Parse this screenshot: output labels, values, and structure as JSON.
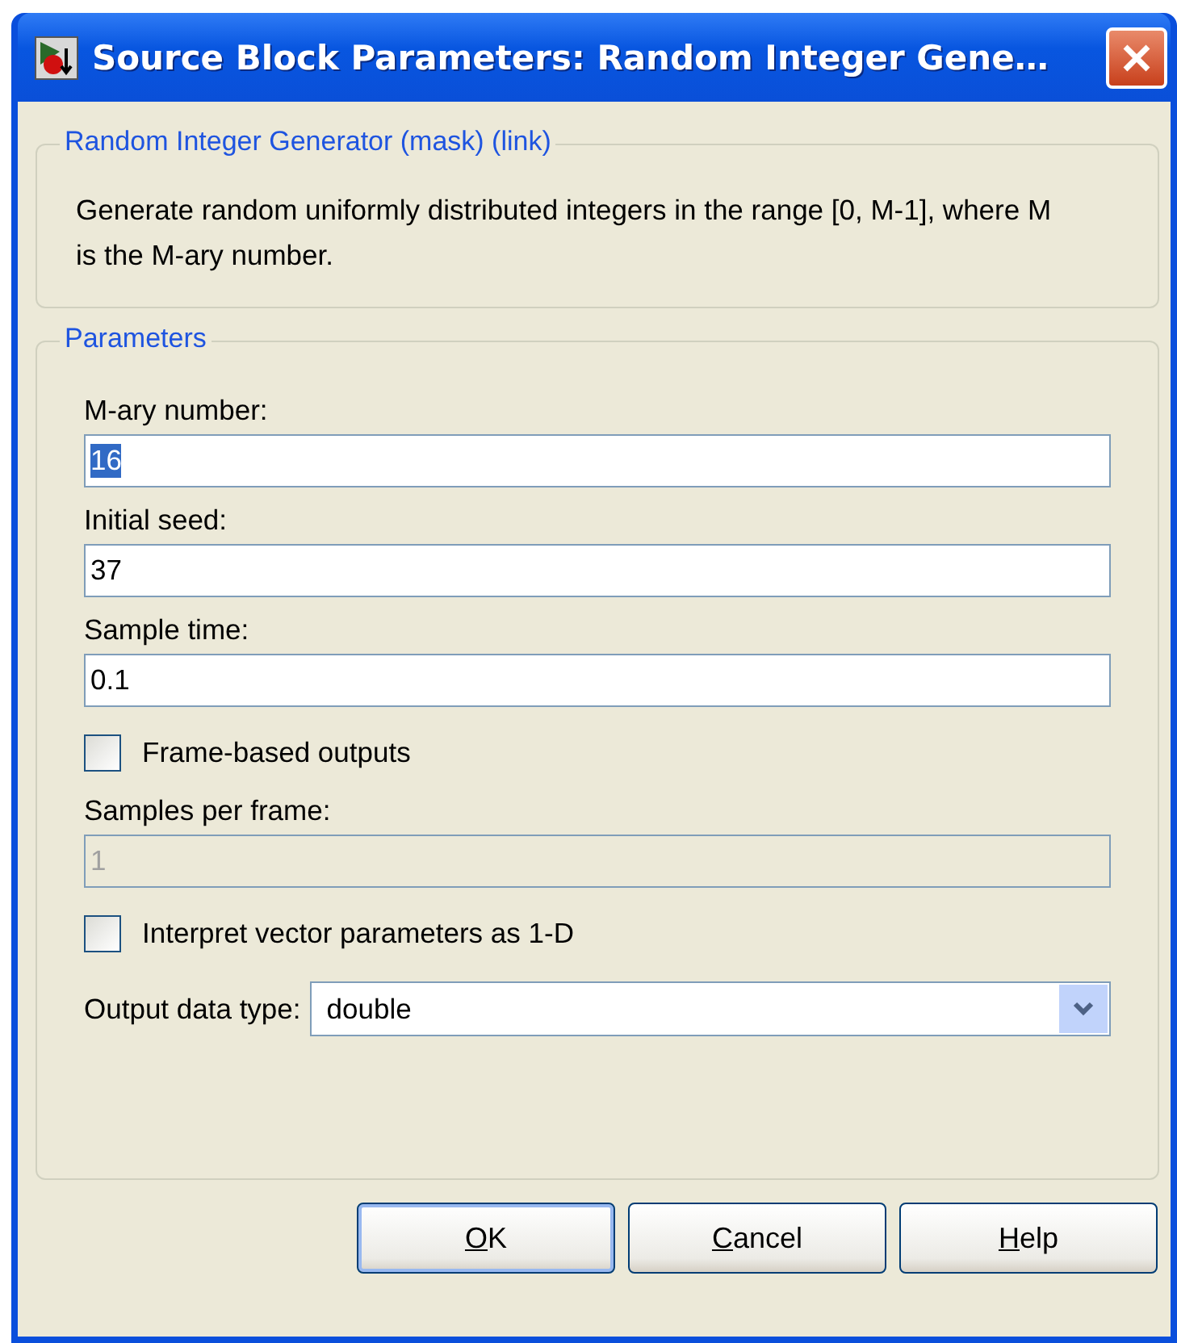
{
  "window": {
    "title": "Source Block Parameters: Random Integer Gene…"
  },
  "description_group": {
    "title": "Random Integer Generator (mask) (link)",
    "text": "Generate random uniformly distributed integers in the range [0, M-1], where M is the M-ary number."
  },
  "parameters_group": {
    "title": "Parameters",
    "items": [
      {
        "kind": "text",
        "label": "M-ary number:",
        "value": "16",
        "selected": true,
        "disabled": false
      },
      {
        "kind": "text",
        "label": "Initial seed:",
        "value": "37",
        "selected": false,
        "disabled": false
      },
      {
        "kind": "text",
        "label": "Sample time:",
        "value": "0.1",
        "selected": false,
        "disabled": false
      },
      {
        "kind": "checkbox",
        "label": "Frame-based outputs",
        "checked": false
      },
      {
        "kind": "text",
        "label": "Samples per frame:",
        "value": "1",
        "selected": false,
        "disabled": true
      },
      {
        "kind": "checkbox",
        "label": "Interpret vector parameters as 1-D",
        "checked": false
      },
      {
        "kind": "dropdown",
        "label": "Output data type:",
        "value": "double"
      }
    ]
  },
  "buttons": [
    {
      "label": "OK",
      "default": true
    },
    {
      "label": "Cancel",
      "default": false
    },
    {
      "label": "Help",
      "default": false
    }
  ]
}
